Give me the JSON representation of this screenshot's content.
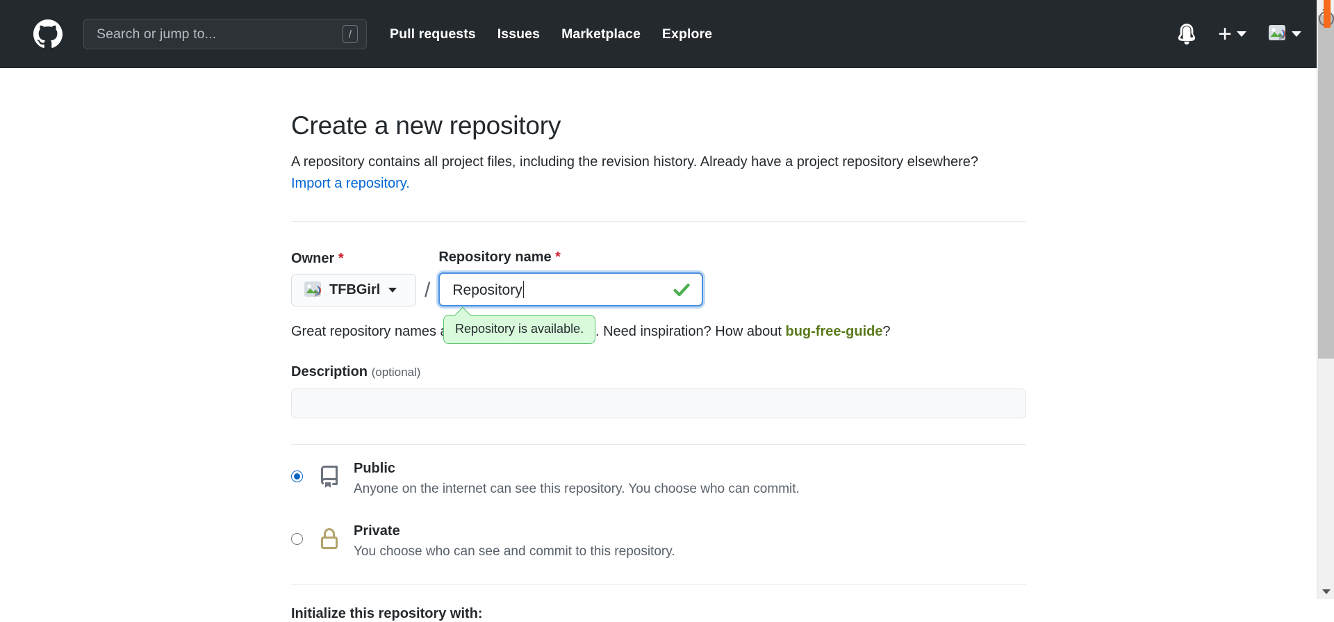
{
  "header": {
    "logo_icon": "github-mark-icon",
    "search": {
      "placeholder": "Search or jump to...",
      "value": "",
      "shortcut_key": "/"
    },
    "nav": [
      {
        "label": "Pull requests"
      },
      {
        "label": "Issues"
      },
      {
        "label": "Marketplace"
      },
      {
        "label": "Explore"
      }
    ],
    "notifications_icon": "bell-icon",
    "create_new_icon": "plus-icon",
    "avatar_icon": "broken-image-avatar-icon",
    "background_color": "#24292e"
  },
  "main": {
    "title": "Create a new repository",
    "description": "A repository contains all project files, including the revision history. Already have a project repository elsewhere?",
    "import_link": "Import a repository.",
    "owner": {
      "label": "Owner",
      "required_marker": "*",
      "value": "TFBGirl",
      "avatar_icon": "broken-image-icon",
      "caret_icon": "caret-down-icon"
    },
    "separator": "/",
    "repo_name": {
      "label": "Repository name",
      "required_marker": "*",
      "value": "Repository",
      "placeholder": "",
      "status_icon": "check-icon",
      "status_color": "#4caf50"
    },
    "availability_tooltip": "Repository is available.",
    "hint": {
      "prefix": "Great repository names are short and memorable. Need inspiration? How about ",
      "suggestion": "bug-free-guide",
      "suffix": "?"
    },
    "descriptionField": {
      "label": "Description",
      "optional_note": "(optional)",
      "value": "",
      "placeholder": ""
    },
    "visibility": [
      {
        "id": "public",
        "title": "Public",
        "subtitle": "Anyone on the internet can see this repository. You choose who can commit.",
        "icon": "repo-book-icon",
        "icon_color": "#6a737d",
        "selected": true
      },
      {
        "id": "private",
        "title": "Private",
        "subtitle": "You choose who can see and commit to this repository.",
        "icon": "lock-icon",
        "icon_color": "#b3a369",
        "selected": false
      }
    ],
    "initialize_title": "Initialize this repository with:"
  },
  "scrollbar": {
    "up_arrow_icon": "chevron-up-icon",
    "down_arrow_icon": "chevron-down-icon",
    "thumb_label": "vertical-scroll-thumb"
  },
  "colors": {
    "header_bg": "#24292e",
    "link": "#0366d6",
    "required": "#cb2431",
    "tooltip_bg": "#d9fbdc",
    "tooltip_border": "#57c06a",
    "focus_ring": "#0366d6"
  }
}
